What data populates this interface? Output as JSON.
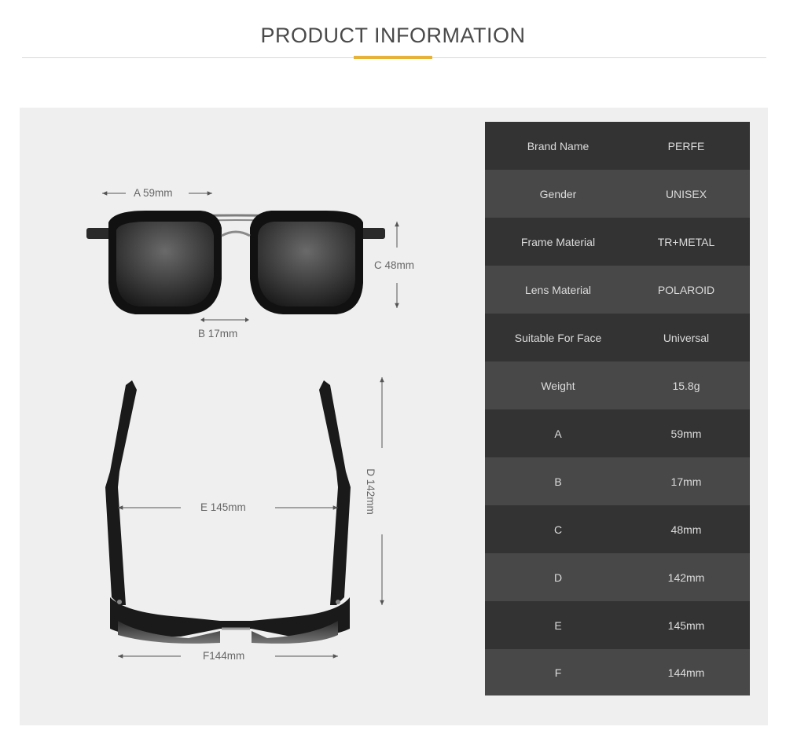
{
  "header": {
    "title": "PRODUCT INFORMATION",
    "accent_color": "#e6b23a"
  },
  "dimensions": {
    "a_label": "A 59mm",
    "b_label": "B 17mm",
    "c_label": "C 48mm",
    "d_label": "D 142mm",
    "e_label": "E 145mm",
    "f_label": "F144mm"
  },
  "specs": [
    {
      "key": "Brand Name",
      "value": "PERFE"
    },
    {
      "key": "Gender",
      "value": "UNISEX"
    },
    {
      "key": "Frame Material",
      "value": "TR+METAL"
    },
    {
      "key": "Lens Material",
      "value": "POLAROID"
    },
    {
      "key": "Suitable For Face",
      "value": "Universal"
    },
    {
      "key": "Weight",
      "value": "15.8g"
    },
    {
      "key": "A",
      "value": "59mm"
    },
    {
      "key": "B",
      "value": "17mm"
    },
    {
      "key": "C",
      "value": "48mm"
    },
    {
      "key": "D",
      "value": "142mm"
    },
    {
      "key": "E",
      "value": "145mm"
    },
    {
      "key": "F",
      "value": "144mm"
    }
  ]
}
